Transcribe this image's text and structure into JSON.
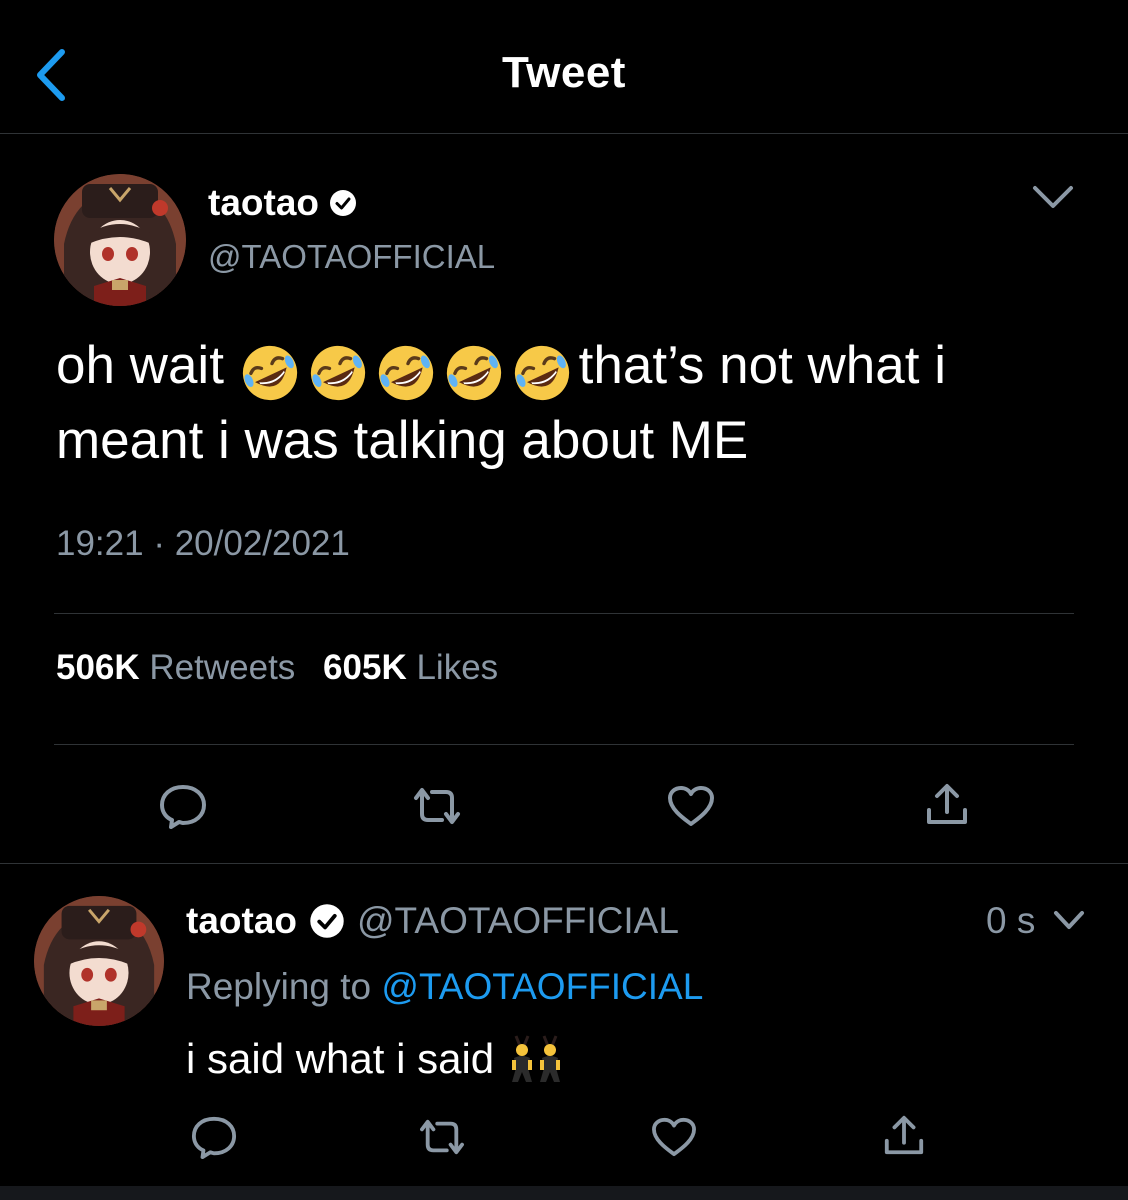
{
  "header": {
    "title": "Tweet",
    "back_icon": "chevron-left-icon"
  },
  "colors": {
    "background": "#000000",
    "accent": "#1d9bf0",
    "secondary_text": "#8b98a5",
    "divider": "#2f3336"
  },
  "tweet": {
    "display_name": "taotao",
    "handle": "@TAOTAOFFICIAL",
    "verified": true,
    "text_before_emoji": "oh wait",
    "emoji": "rolling-on-the-floor-laughing",
    "emoji_count": 5,
    "text_after_emoji": "that’s not what i meant i was talking about ME",
    "time": "19:21",
    "separator": "·",
    "date": "20/02/2021",
    "retweets_count": "506K",
    "retweets_label": "Retweets",
    "likes_count": "605K",
    "likes_label": "Likes",
    "actions": [
      "reply-icon",
      "retweet-icon",
      "like-icon",
      "share-icon"
    ]
  },
  "reply": {
    "display_name": "taotao",
    "handle": "@TAOTAOFFICIAL",
    "verified": true,
    "time": "0 s",
    "replying_prefix": "Replying to",
    "replying_handle": "@TAOTAOFFICIAL",
    "text": "i said what i said",
    "emoji": "people-with-bunny-ears",
    "actions": [
      "reply-icon",
      "retweet-icon",
      "like-icon",
      "share-icon"
    ]
  }
}
